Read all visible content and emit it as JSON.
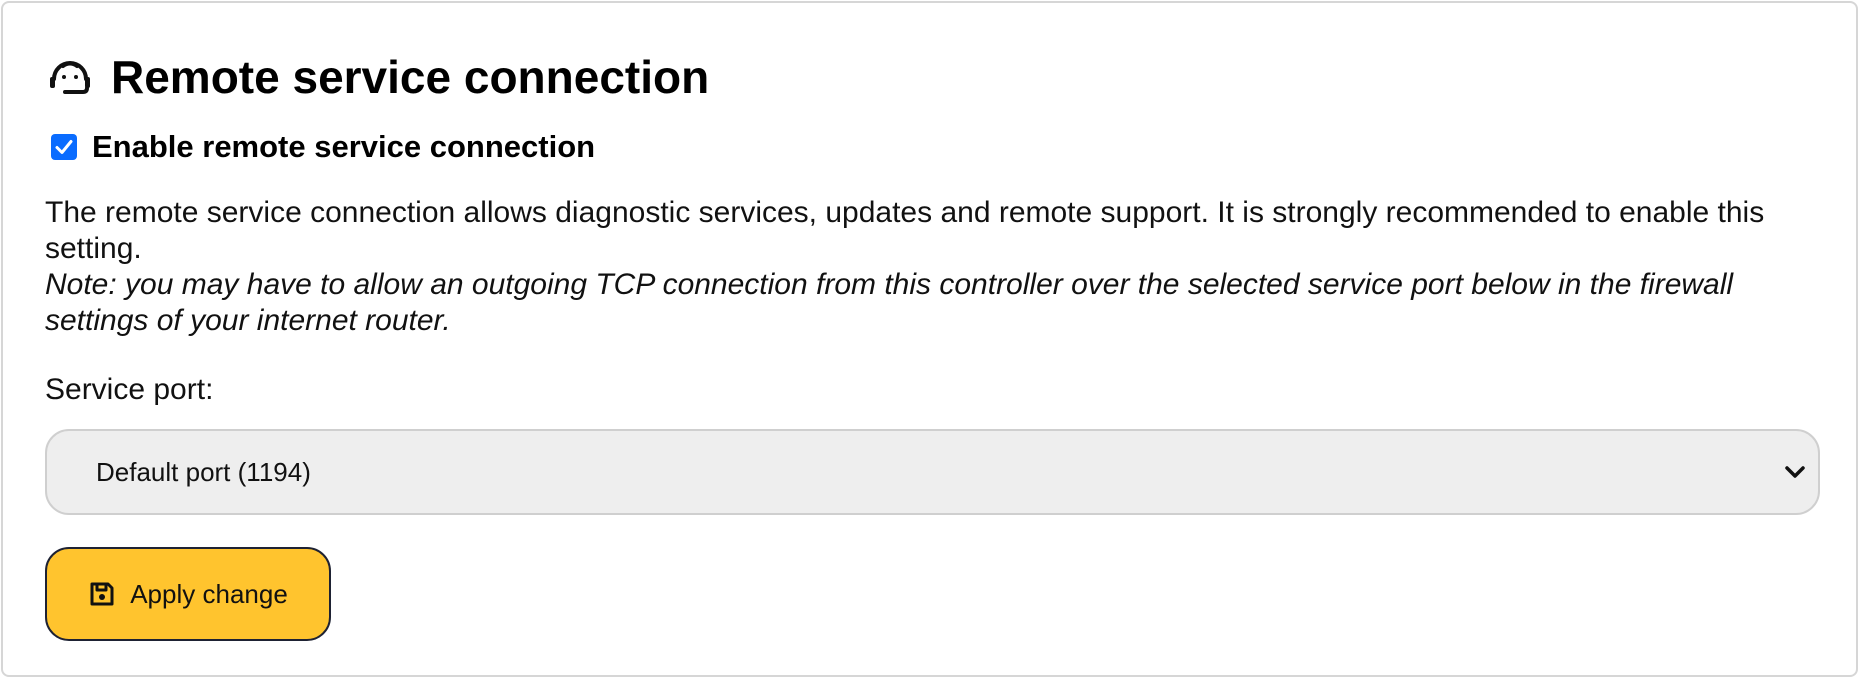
{
  "section": {
    "title": "Remote service connection",
    "icon": "headset-icon"
  },
  "enable_option": {
    "label": "Enable remote service connection",
    "checked": true,
    "accent_color": "#0a6cff"
  },
  "description": {
    "text": "The remote service connection allows diagnostic services, updates and remote support. It is strongly recommended to enable this setting.",
    "note": "Note: you may have to allow an outgoing TCP connection from this controller over the selected service port below in the firewall settings of your internet router."
  },
  "service_port": {
    "label": "Service port:",
    "selected": "Default port (1194)"
  },
  "apply_button": {
    "label": "Apply change",
    "icon": "floppy-disk-icon",
    "color": "#ffc42e"
  }
}
